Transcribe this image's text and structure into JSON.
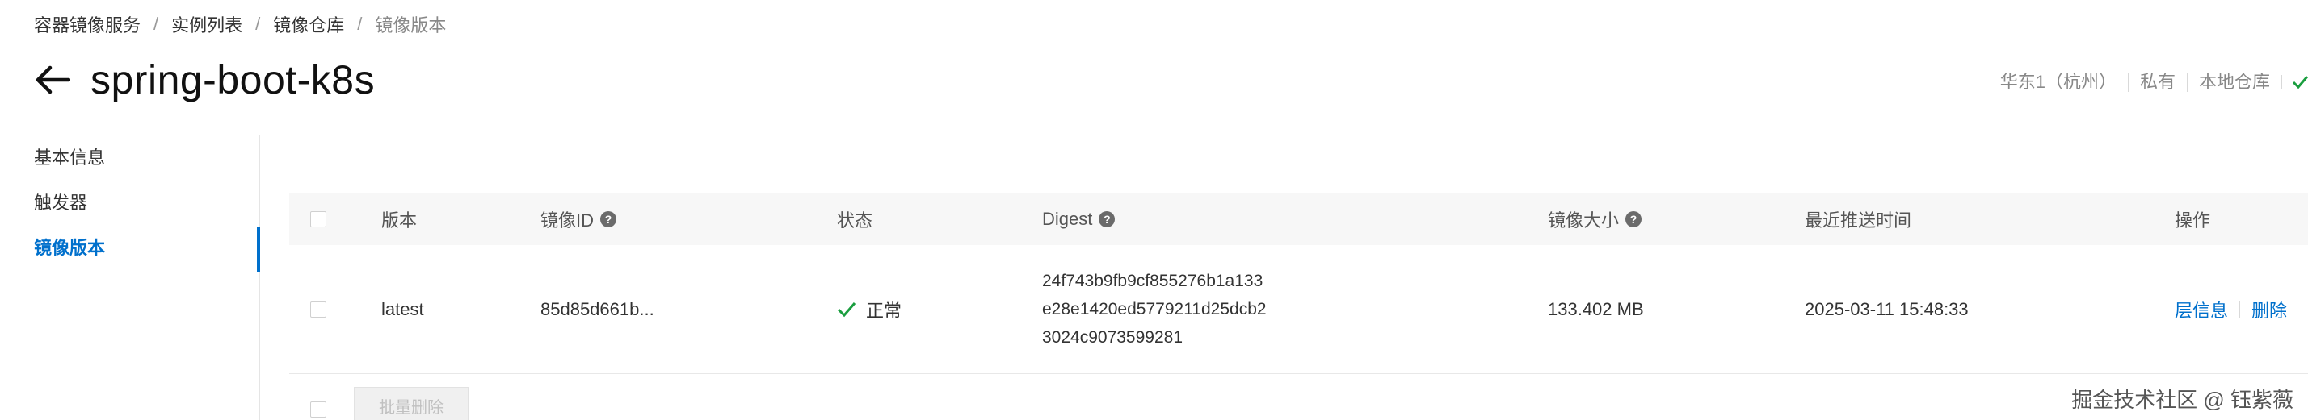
{
  "breadcrumb": [
    "容器镜像服务",
    "实例列表",
    "镜像仓库",
    "镜像版本"
  ],
  "breadcrumb_sep": "/",
  "title": "spring-boot-k8s",
  "meta_tags": [
    "华东1（杭州）",
    "私有",
    "本地仓库"
  ],
  "sidenav": {
    "items": [
      {
        "label": "基本信息",
        "active": false
      },
      {
        "label": "触发器",
        "active": false
      },
      {
        "label": "镜像版本",
        "active": true
      }
    ]
  },
  "table": {
    "headers": {
      "version": "版本",
      "image_id": "镜像ID",
      "status": "状态",
      "digest": "Digest",
      "size": "镜像大小",
      "pushed": "最近推送时间",
      "ops": "操作"
    },
    "help_glyph": "?",
    "rows": [
      {
        "version": "latest",
        "image_id": "85d85d661b...",
        "status": "正常",
        "digest": [
          "24f743b9fb9cf855276b1a133",
          "e28e1420ed5779211d25dcb2",
          "3024c9073599281"
        ],
        "size": "133.402 MB",
        "pushed": "2025-03-11 15:48:33",
        "ops": [
          "层信息",
          "删除"
        ]
      }
    ]
  },
  "batch_delete": "批量删除",
  "watermark": "掘金技术社区 @ 钰紫薇",
  "colors": {
    "accent": "#0070cc",
    "success": "#1a9e3f"
  }
}
